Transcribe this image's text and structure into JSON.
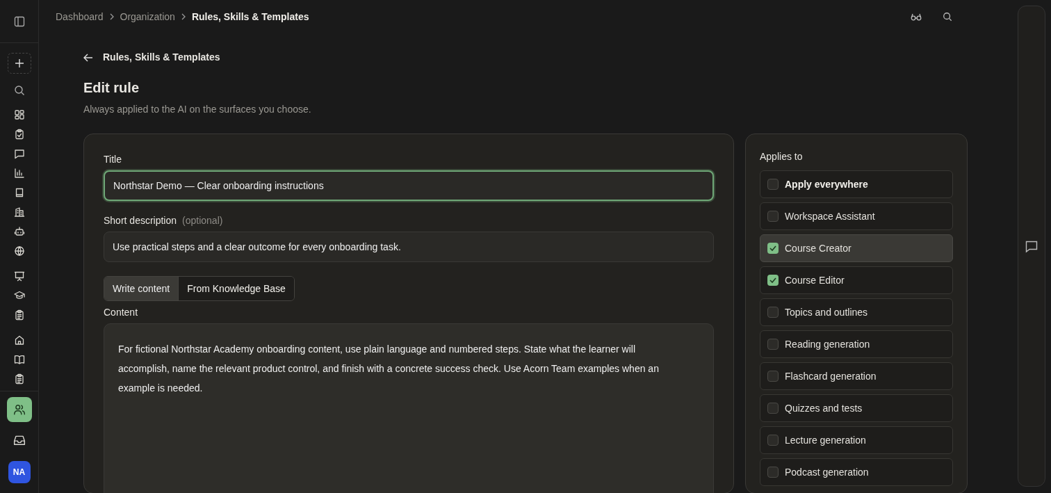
{
  "sidebar": {
    "items": [
      {
        "kind": "grid",
        "selected": false
      },
      {
        "kind": "clipboard-check",
        "selected": false
      },
      {
        "kind": "chat",
        "selected": false
      },
      {
        "kind": "chart",
        "selected": false
      },
      {
        "kind": "book",
        "selected": false
      },
      {
        "kind": "building",
        "selected": false
      },
      {
        "kind": "robot",
        "selected": false
      },
      {
        "kind": "globe",
        "selected": false
      },
      {
        "kind": "presentation",
        "selected": false
      },
      {
        "kind": "cap",
        "selected": false
      },
      {
        "kind": "clipboard",
        "selected": false
      },
      {
        "kind": "home",
        "selected": false
      },
      {
        "kind": "open-book",
        "selected": false
      },
      {
        "kind": "clipboard",
        "selected": false
      }
    ],
    "bottom": [
      {
        "kind": "people",
        "selected": true
      },
      {
        "kind": "inbox",
        "selected": false
      }
    ],
    "avatar": "NA"
  },
  "breadcrumbs": [
    {
      "label": "Dashboard",
      "current": false
    },
    {
      "label": "Organization",
      "current": false
    },
    {
      "label": "Rules, Skills & Templates",
      "current": true
    }
  ],
  "back_link": "Rules, Skills & Templates",
  "heading": "Edit rule",
  "subheading": "Always applied to the AI on the surfaces you choose.",
  "form": {
    "title_label": "Title",
    "title_value": "Northstar Demo — Clear onboarding instructions",
    "title_focused": true,
    "description_label": "Short description",
    "description_hint": "(optional)",
    "description_value": "Use practical steps and a clear outcome for every onboarding task.",
    "tabs": [
      {
        "label": "Write content",
        "selected": true
      },
      {
        "label": "From Knowledge Base",
        "selected": false
      }
    ],
    "content_label": "Content",
    "content_value": "For fictional Northstar Academy onboarding content, use plain language and numbered steps. State what the learner will accomplish, name the relevant product control, and finish with a concrete success check. Use Acorn Team examples when an example is needed."
  },
  "applies_to": {
    "label": "Applies to",
    "items": [
      {
        "label": "Apply everywhere",
        "checked": false,
        "highlighted": false,
        "emphasis": true
      },
      {
        "label": "Workspace Assistant",
        "checked": false,
        "highlighted": false,
        "emphasis": false
      },
      {
        "label": "Course Creator",
        "checked": true,
        "highlighted": true,
        "emphasis": false
      },
      {
        "label": "Course Editor",
        "checked": true,
        "highlighted": false,
        "emphasis": false
      },
      {
        "label": "Topics and outlines",
        "checked": false,
        "highlighted": false,
        "emphasis": false
      },
      {
        "label": "Reading generation",
        "checked": false,
        "highlighted": false,
        "emphasis": false
      },
      {
        "label": "Flashcard generation",
        "checked": false,
        "highlighted": false,
        "emphasis": false
      },
      {
        "label": "Quizzes and tests",
        "checked": false,
        "highlighted": false,
        "emphasis": false
      },
      {
        "label": "Lecture generation",
        "checked": false,
        "highlighted": false,
        "emphasis": false
      },
      {
        "label": "Podcast generation",
        "checked": false,
        "highlighted": false,
        "emphasis": false
      }
    ]
  }
}
